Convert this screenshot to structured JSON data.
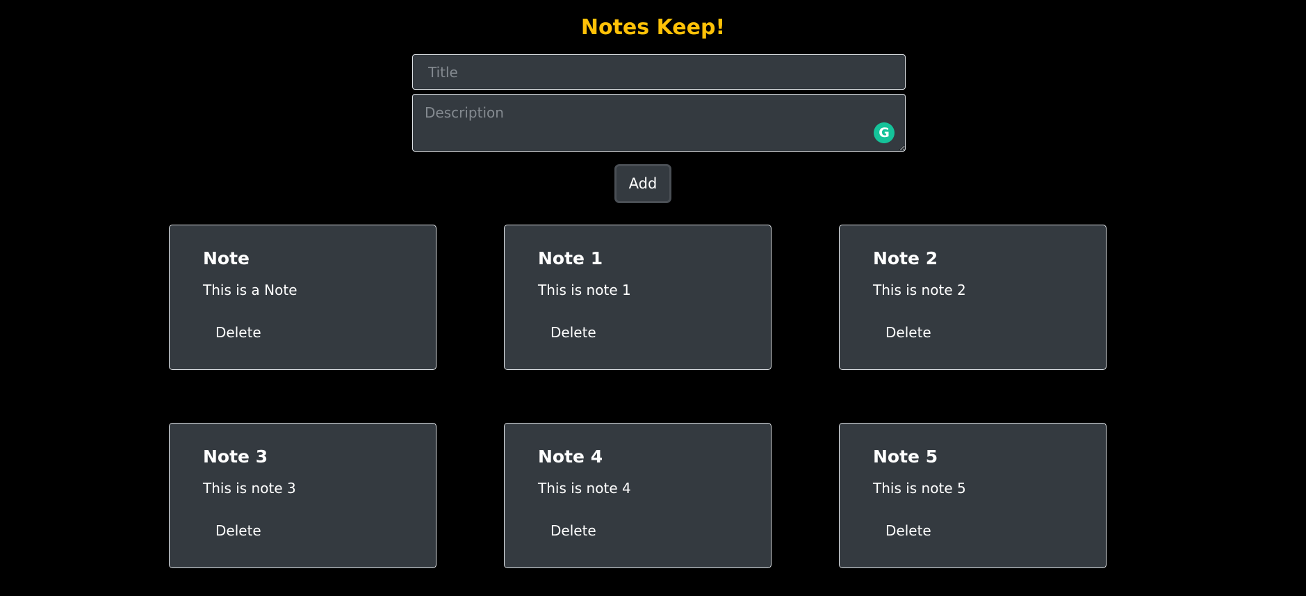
{
  "app": {
    "title": "Notes Keep!",
    "accent_color": "#ffc107",
    "background_color": "#000000",
    "card_color": "#343a40"
  },
  "form": {
    "title_placeholder": "Title",
    "title_value": "",
    "description_placeholder": "Description",
    "description_value": "",
    "grammarly_icon": "grammarly-icon",
    "grammarly_glyph": "G",
    "add_label": "Add"
  },
  "notes": [
    {
      "title": "Note",
      "description": "This is a Note",
      "delete_label": "Delete"
    },
    {
      "title": "Note 1",
      "description": "This is note 1",
      "delete_label": "Delete"
    },
    {
      "title": "Note 2",
      "description": "This is note 2",
      "delete_label": "Delete"
    },
    {
      "title": "Note 3",
      "description": "This is note 3",
      "delete_label": "Delete"
    },
    {
      "title": "Note 4",
      "description": "This is note 4",
      "delete_label": "Delete"
    },
    {
      "title": "Note 5",
      "description": "This is note 5",
      "delete_label": "Delete"
    }
  ]
}
